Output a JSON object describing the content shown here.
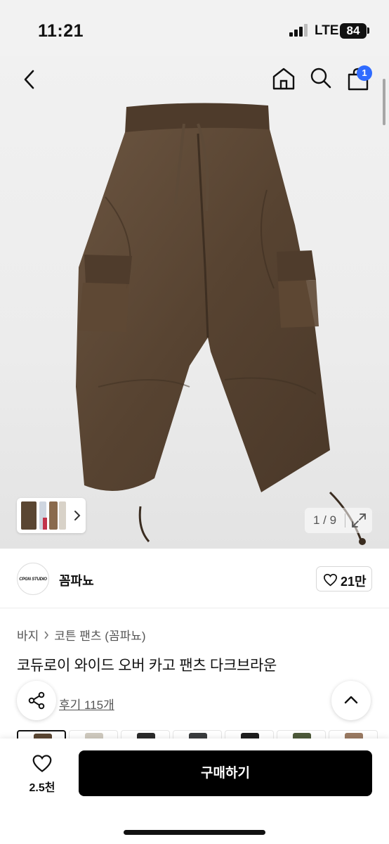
{
  "status_bar": {
    "time": "11:21",
    "network": "LTE",
    "battery": "84"
  },
  "nav": {
    "cart_count": "1"
  },
  "gallery": {
    "counter": "1 / 9"
  },
  "seller": {
    "logo_text": "CPGN STUDIO",
    "name": "꼼파뇨",
    "likes": "21만"
  },
  "breadcrumb": [
    "바지",
    "코튼 팬츠 (꼼파뇨)"
  ],
  "product": {
    "title": "코듀로이 와이드 오버 카고 팬츠 다크브라운",
    "reviews": "후기 115개"
  },
  "bottom": {
    "wish_count": "2.5천",
    "buy_label": "구매하기"
  },
  "colors": {
    "accent": "#2f6bff",
    "pants": "#5a4632",
    "buy_button": "#000000"
  }
}
